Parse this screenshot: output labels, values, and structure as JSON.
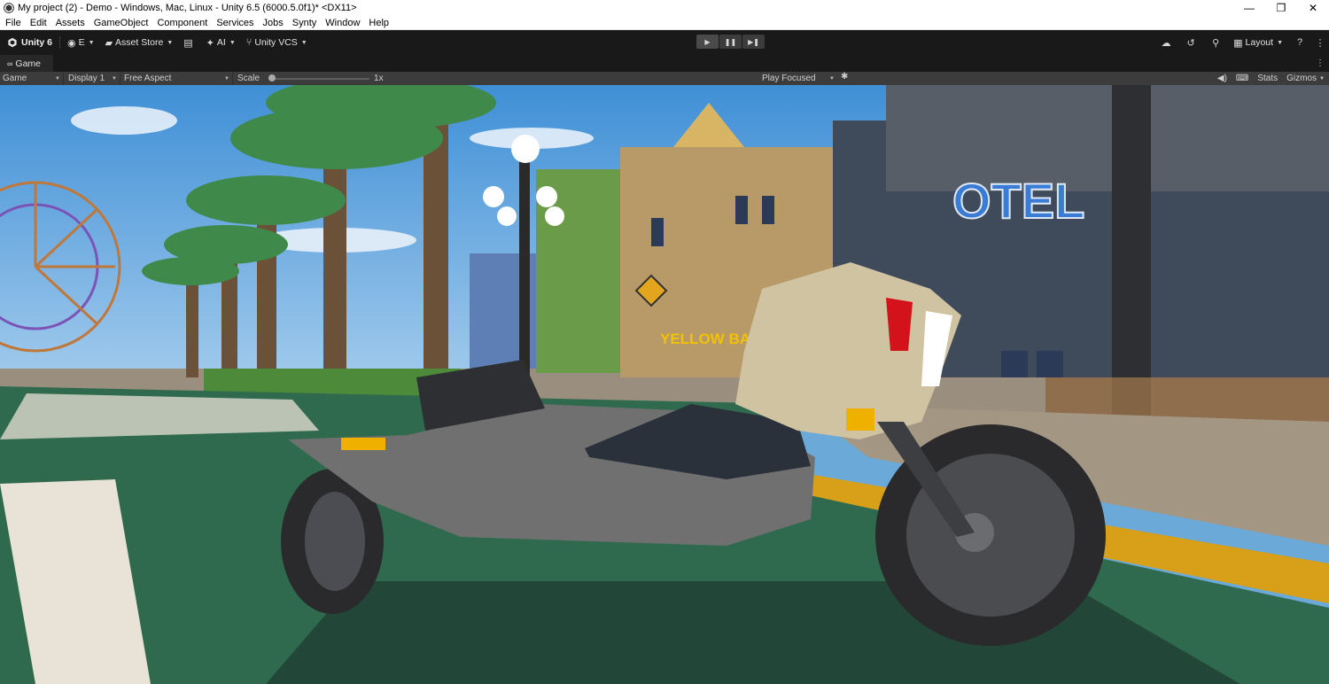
{
  "window": {
    "title": "My project (2) - Demo - Windows, Mac, Linux - Unity 6.5 (6000.5.0f1)* <DX11>",
    "minimize": "—",
    "maximize": "❐",
    "close": "✕"
  },
  "menu": [
    "File",
    "Edit",
    "Assets",
    "GameObject",
    "Component",
    "Services",
    "Jobs",
    "Synty",
    "Window",
    "Help"
  ],
  "toolbar": {
    "brand": "Unity 6",
    "account": "E",
    "asset_store": "Asset Store",
    "ai": "AI",
    "vcs": "Unity VCS",
    "layout": "Layout"
  },
  "tab": {
    "game": "Game"
  },
  "game_toolbar": {
    "view": "Game",
    "display": "Display 1",
    "aspect": "Free Aspect",
    "scale_label": "Scale",
    "scale_value": "1x",
    "scale_level": 0.0,
    "play_mode": "Play Focused",
    "stats": "Stats",
    "gizmos": "Gizmos"
  },
  "scene_signs": {
    "hotel": "OTEL",
    "shop": "YELLOW BANANA"
  },
  "colors": {
    "toolbar_bg": "#191919",
    "game_toolbar_bg": "#3c3c3c",
    "sky": "#6aa9d8",
    "road_green": "#2f6a4e",
    "hotel_sign": "#3a7bd5",
    "banana_sign": "#f2c200"
  }
}
